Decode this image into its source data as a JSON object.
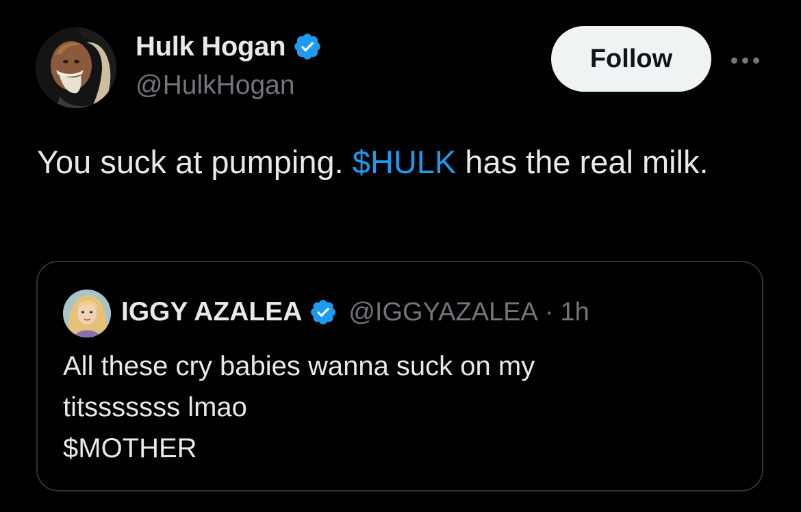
{
  "author": {
    "name": "Hulk Hogan",
    "handle": "@HulkHogan",
    "verified_icon": "verified-badge-icon"
  },
  "actions": {
    "follow_label": "Follow",
    "more_icon": "more-options-icon"
  },
  "tweet": {
    "text_before": "You suck at pumping. ",
    "cashtag": "$HULK",
    "text_after": " has the real milk."
  },
  "quote": {
    "name": "IGGY AZALEA",
    "handle": "@IGGYAZALEA",
    "separator": "·",
    "time": "1h",
    "lines": [
      "All these cry babies wanna suck on my",
      "titsssssss lmao",
      "$MOTHER"
    ]
  },
  "colors": {
    "background": "#000000",
    "text": "#e7e9ea",
    "secondary": "#71767b",
    "accent": "#1d9bf0",
    "follow_bg": "#eff3f4",
    "border": "#2f3336"
  }
}
